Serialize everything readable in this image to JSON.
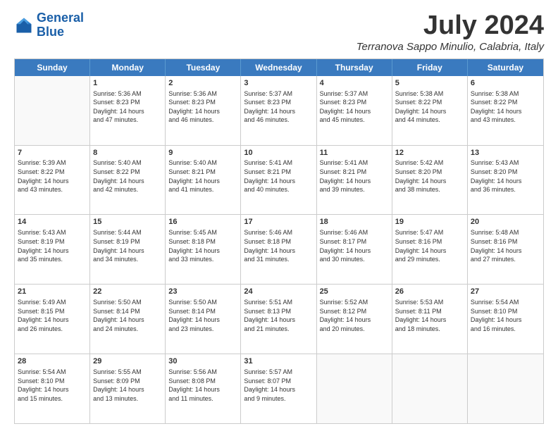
{
  "logo": {
    "line1": "General",
    "line2": "Blue"
  },
  "title": "July 2024",
  "subtitle": "Terranova Sappo Minulio, Calabria, Italy",
  "header": {
    "days": [
      "Sunday",
      "Monday",
      "Tuesday",
      "Wednesday",
      "Thursday",
      "Friday",
      "Saturday"
    ]
  },
  "weeks": [
    [
      {
        "day": "",
        "info": ""
      },
      {
        "day": "1",
        "info": "Sunrise: 5:36 AM\nSunset: 8:23 PM\nDaylight: 14 hours\nand 47 minutes."
      },
      {
        "day": "2",
        "info": "Sunrise: 5:36 AM\nSunset: 8:23 PM\nDaylight: 14 hours\nand 46 minutes."
      },
      {
        "day": "3",
        "info": "Sunrise: 5:37 AM\nSunset: 8:23 PM\nDaylight: 14 hours\nand 46 minutes."
      },
      {
        "day": "4",
        "info": "Sunrise: 5:37 AM\nSunset: 8:23 PM\nDaylight: 14 hours\nand 45 minutes."
      },
      {
        "day": "5",
        "info": "Sunrise: 5:38 AM\nSunset: 8:22 PM\nDaylight: 14 hours\nand 44 minutes."
      },
      {
        "day": "6",
        "info": "Sunrise: 5:38 AM\nSunset: 8:22 PM\nDaylight: 14 hours\nand 43 minutes."
      }
    ],
    [
      {
        "day": "7",
        "info": "Sunrise: 5:39 AM\nSunset: 8:22 PM\nDaylight: 14 hours\nand 43 minutes."
      },
      {
        "day": "8",
        "info": "Sunrise: 5:40 AM\nSunset: 8:22 PM\nDaylight: 14 hours\nand 42 minutes."
      },
      {
        "day": "9",
        "info": "Sunrise: 5:40 AM\nSunset: 8:21 PM\nDaylight: 14 hours\nand 41 minutes."
      },
      {
        "day": "10",
        "info": "Sunrise: 5:41 AM\nSunset: 8:21 PM\nDaylight: 14 hours\nand 40 minutes."
      },
      {
        "day": "11",
        "info": "Sunrise: 5:41 AM\nSunset: 8:21 PM\nDaylight: 14 hours\nand 39 minutes."
      },
      {
        "day": "12",
        "info": "Sunrise: 5:42 AM\nSunset: 8:20 PM\nDaylight: 14 hours\nand 38 minutes."
      },
      {
        "day": "13",
        "info": "Sunrise: 5:43 AM\nSunset: 8:20 PM\nDaylight: 14 hours\nand 36 minutes."
      }
    ],
    [
      {
        "day": "14",
        "info": "Sunrise: 5:43 AM\nSunset: 8:19 PM\nDaylight: 14 hours\nand 35 minutes."
      },
      {
        "day": "15",
        "info": "Sunrise: 5:44 AM\nSunset: 8:19 PM\nDaylight: 14 hours\nand 34 minutes."
      },
      {
        "day": "16",
        "info": "Sunrise: 5:45 AM\nSunset: 8:18 PM\nDaylight: 14 hours\nand 33 minutes."
      },
      {
        "day": "17",
        "info": "Sunrise: 5:46 AM\nSunset: 8:18 PM\nDaylight: 14 hours\nand 31 minutes."
      },
      {
        "day": "18",
        "info": "Sunrise: 5:46 AM\nSunset: 8:17 PM\nDaylight: 14 hours\nand 30 minutes."
      },
      {
        "day": "19",
        "info": "Sunrise: 5:47 AM\nSunset: 8:16 PM\nDaylight: 14 hours\nand 29 minutes."
      },
      {
        "day": "20",
        "info": "Sunrise: 5:48 AM\nSunset: 8:16 PM\nDaylight: 14 hours\nand 27 minutes."
      }
    ],
    [
      {
        "day": "21",
        "info": "Sunrise: 5:49 AM\nSunset: 8:15 PM\nDaylight: 14 hours\nand 26 minutes."
      },
      {
        "day": "22",
        "info": "Sunrise: 5:50 AM\nSunset: 8:14 PM\nDaylight: 14 hours\nand 24 minutes."
      },
      {
        "day": "23",
        "info": "Sunrise: 5:50 AM\nSunset: 8:14 PM\nDaylight: 14 hours\nand 23 minutes."
      },
      {
        "day": "24",
        "info": "Sunrise: 5:51 AM\nSunset: 8:13 PM\nDaylight: 14 hours\nand 21 minutes."
      },
      {
        "day": "25",
        "info": "Sunrise: 5:52 AM\nSunset: 8:12 PM\nDaylight: 14 hours\nand 20 minutes."
      },
      {
        "day": "26",
        "info": "Sunrise: 5:53 AM\nSunset: 8:11 PM\nDaylight: 14 hours\nand 18 minutes."
      },
      {
        "day": "27",
        "info": "Sunrise: 5:54 AM\nSunset: 8:10 PM\nDaylight: 14 hours\nand 16 minutes."
      }
    ],
    [
      {
        "day": "28",
        "info": "Sunrise: 5:54 AM\nSunset: 8:10 PM\nDaylight: 14 hours\nand 15 minutes."
      },
      {
        "day": "29",
        "info": "Sunrise: 5:55 AM\nSunset: 8:09 PM\nDaylight: 14 hours\nand 13 minutes."
      },
      {
        "day": "30",
        "info": "Sunrise: 5:56 AM\nSunset: 8:08 PM\nDaylight: 14 hours\nand 11 minutes."
      },
      {
        "day": "31",
        "info": "Sunrise: 5:57 AM\nSunset: 8:07 PM\nDaylight: 14 hours\nand 9 minutes."
      },
      {
        "day": "",
        "info": ""
      },
      {
        "day": "",
        "info": ""
      },
      {
        "day": "",
        "info": ""
      }
    ]
  ]
}
